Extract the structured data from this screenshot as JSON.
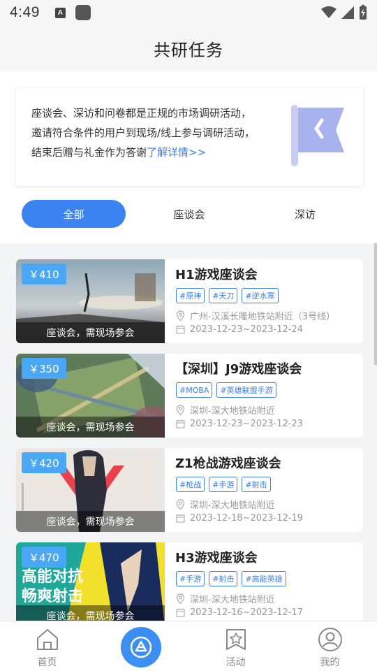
{
  "status": {
    "time": "4:49",
    "a_icon": "A"
  },
  "header": {
    "title": "共研任务"
  },
  "intro": {
    "line1": "座谈会、深访和问卷都是正规的市场调研活动，",
    "line2": "邀请符合条件的用户到现场/线上参与调研活动，",
    "line3": "结束后赠与礼金作为答谢",
    "link": "了解详情>>"
  },
  "tabs": [
    {
      "label": "全部",
      "active": true
    },
    {
      "label": "座谈会",
      "active": false
    },
    {
      "label": "深访",
      "active": false
    }
  ],
  "items": [
    {
      "price": "￥410",
      "caption": "座谈会，需现场参会",
      "title": "H1游戏座谈会",
      "tags": [
        "#原神",
        "#天刀",
        "#逆水寒"
      ],
      "location": "广州-汉溪长隆地铁站附近（3号线）",
      "date": "2023-12-23~2023-12-24"
    },
    {
      "price": "￥350",
      "caption": "座谈会，需现场参会",
      "title": "【深圳】J9游戏座谈会",
      "tags": [
        "#MOBA",
        "#英雄联盟手游"
      ],
      "location": "深圳-深大地铁站附近",
      "date": "2023-12-23~2023-12-23"
    },
    {
      "price": "￥420",
      "caption": "座谈会，需现场参会",
      "title": "Z1枪战游戏座谈会",
      "tags": [
        "#枪战",
        "#手游",
        "#射击"
      ],
      "location": "深圳-深大地铁站附近",
      "date": "2023-12-18~2023-12-19"
    },
    {
      "price": "￥470",
      "caption": "座谈会，需现场参会",
      "title": "H3游戏座谈会",
      "tags": [
        "#手游",
        "#射击",
        "#高能英雄"
      ],
      "location": "深圳-深大地铁站附近",
      "date": "2023-12-16~2023-12-17",
      "thumb_text1": "高能对抗",
      "thumb_text2": "畅爽射击"
    }
  ],
  "nav": [
    {
      "label": "首页",
      "icon": "home-icon"
    },
    {
      "label": "",
      "icon": "center-logo-icon"
    },
    {
      "label": "活动",
      "icon": "activity-icon"
    },
    {
      "label": "我的",
      "icon": "profile-icon"
    }
  ],
  "colors": {
    "accent": "#3a83f1",
    "price_badge": "#4aa7f5",
    "tag": "#3a7ee8"
  }
}
